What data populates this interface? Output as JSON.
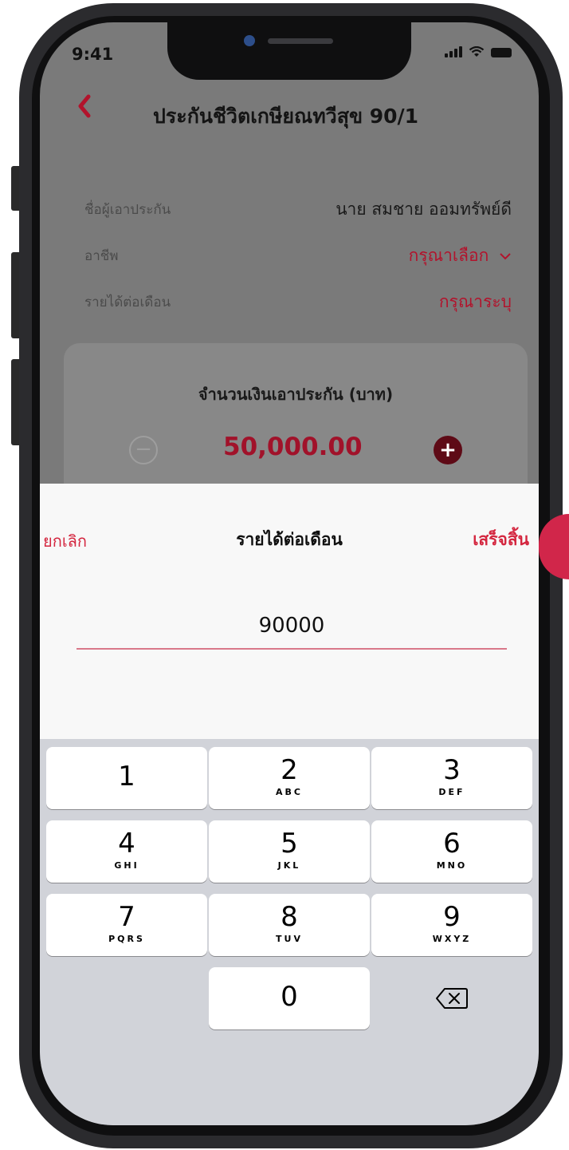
{
  "status_bar": {
    "time": "9:41"
  },
  "header": {
    "title": "ประกันชีวิตเกษียณทวีสุข 90/1"
  },
  "form": {
    "insured_label": "ชื่อผู้เอาประกัน",
    "insured_value": "นาย สมชาย ออมทรัพย์ดี",
    "occupation_label": "อาชีพ",
    "occupation_value": "กรุณาเลือก",
    "income_label": "รายได้ต่อเดือน",
    "income_value": "กรุณาระบุ"
  },
  "coverage": {
    "title": "จำนวนเงินเอาประกัน (บาท)",
    "amount": "50,000.00",
    "minus_symbol": "−",
    "plus_symbol": "+"
  },
  "sheet": {
    "cancel_label": "ยกเลิก",
    "title": "รายได้ต่อเดือน",
    "done_label": "เสร็จสิ้น",
    "input_value": "90000"
  },
  "keypad": {
    "keys": [
      {
        "digit": "1",
        "letters": ""
      },
      {
        "digit": "2",
        "letters": "ABC"
      },
      {
        "digit": "3",
        "letters": "DEF"
      },
      {
        "digit": "4",
        "letters": "GHI"
      },
      {
        "digit": "5",
        "letters": "JKL"
      },
      {
        "digit": "6",
        "letters": "MNO"
      },
      {
        "digit": "7",
        "letters": "PQRS"
      },
      {
        "digit": "8",
        "letters": "TUV"
      },
      {
        "digit": "9",
        "letters": "WXYZ"
      },
      {
        "digit": "0",
        "letters": ""
      }
    ]
  },
  "colors": {
    "brand_red": "#b2132c",
    "sheet_action": "#d4263f",
    "keyboard_bg": "#d1d3d9"
  },
  "icons": {
    "back": "chevron-left-icon",
    "dropdown": "chevron-down-icon",
    "delete": "backspace-icon"
  }
}
